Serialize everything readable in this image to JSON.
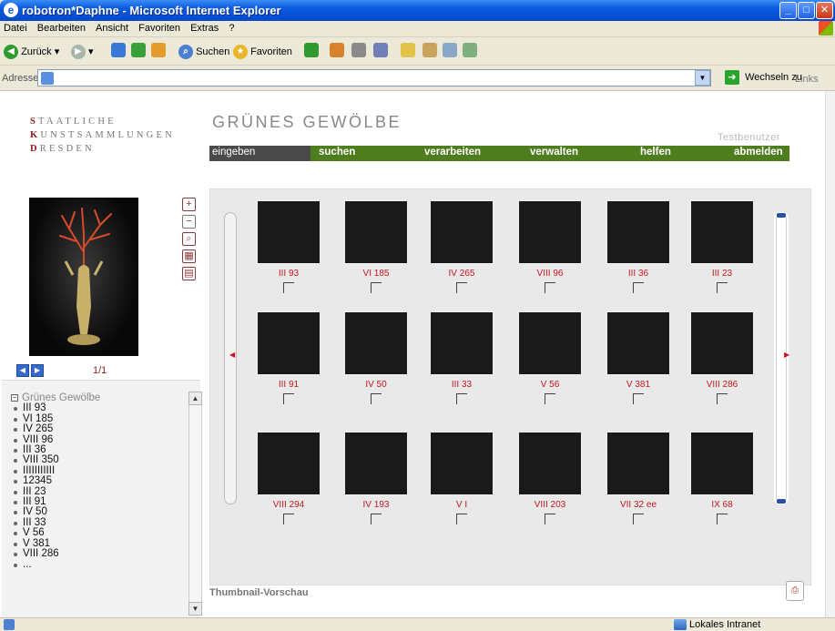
{
  "window": {
    "title": "robotron*Daphne - Microsoft Internet Explorer"
  },
  "menu": [
    "Datei",
    "Bearbeiten",
    "Ansicht",
    "Favoriten",
    "Extras",
    "?"
  ],
  "toolbar": {
    "back_label": "Zurück",
    "search_label": "Suchen",
    "favorites_label": "Favoriten"
  },
  "address": {
    "label": "Adresse",
    "go_label": "Wechseln zu",
    "links_label": "Links"
  },
  "site": {
    "logo_lines": [
      {
        "cap": "S",
        "rest": "TAATLICHE"
      },
      {
        "cap": "K",
        "rest": "UNSTSAMMLUNGEN"
      },
      {
        "cap": "D",
        "rest": "RESDEN"
      }
    ],
    "collection_title": "GRÜNES GEWÖLBE",
    "user": "Testbenutzer"
  },
  "nav": {
    "items": [
      "eingeben",
      "suchen",
      "verarbeiten",
      "verwalten",
      "helfen",
      "abmelden"
    ],
    "active_index": 0
  },
  "preview": {
    "page_count": "1/1"
  },
  "tree": {
    "root": "Grünes Gewölbe",
    "items": [
      "III 93",
      "VI 185",
      "IV 265",
      "VIII 96",
      "III 36",
      "VIII 350",
      "IIIIIIIIIII",
      "12345",
      "III 23",
      "III 91",
      "IV 50",
      "III 33",
      "V 56",
      "V 381",
      "VIII 286",
      "..."
    ]
  },
  "gallery": {
    "caption": "Thumbnail-Vorschau",
    "rows": [
      [
        "III 93",
        "VI 185",
        "IV 265",
        "VIII 96",
        "III 36",
        "III 23"
      ],
      [
        "III 91",
        "IV 50",
        "III 33",
        "V 56",
        "V 381",
        "VIII 286"
      ],
      [
        "VIII 294",
        "IV 193",
        "V I",
        "VIII 203",
        "VII 32 ee",
        "IX 68"
      ]
    ]
  },
  "status": {
    "zone": "Lokales Intranet"
  },
  "colors": {
    "nav_green": "#4e7d1e",
    "accent_red": "#c0181e",
    "title_blue": "#0a5be0"
  }
}
